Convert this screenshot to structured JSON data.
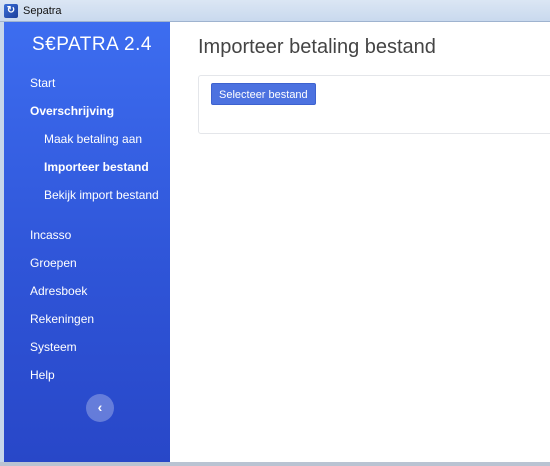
{
  "window": {
    "title": "Sepatra",
    "icon": "sepatra-app-icon"
  },
  "sidebar": {
    "brand": "S€PATRA 2.4",
    "items": [
      {
        "label": "Start"
      },
      {
        "label": "Overschrijving"
      },
      {
        "label": "Maak betaling aan"
      },
      {
        "label": "Importeer bestand"
      },
      {
        "label": "Bekijk import bestand"
      },
      {
        "label": "Incasso"
      },
      {
        "label": "Groepen"
      },
      {
        "label": "Adresboek"
      },
      {
        "label": "Rekeningen"
      },
      {
        "label": "Systeem"
      },
      {
        "label": "Help"
      }
    ],
    "collapse_icon": "‹"
  },
  "main": {
    "title": "Importeer betaling bestand",
    "select_file_label": "Selecteer bestand"
  },
  "colors": {
    "sidebar_top": "#3d6df0",
    "sidebar_bottom": "#2847c8",
    "button": "#4c72e0"
  }
}
